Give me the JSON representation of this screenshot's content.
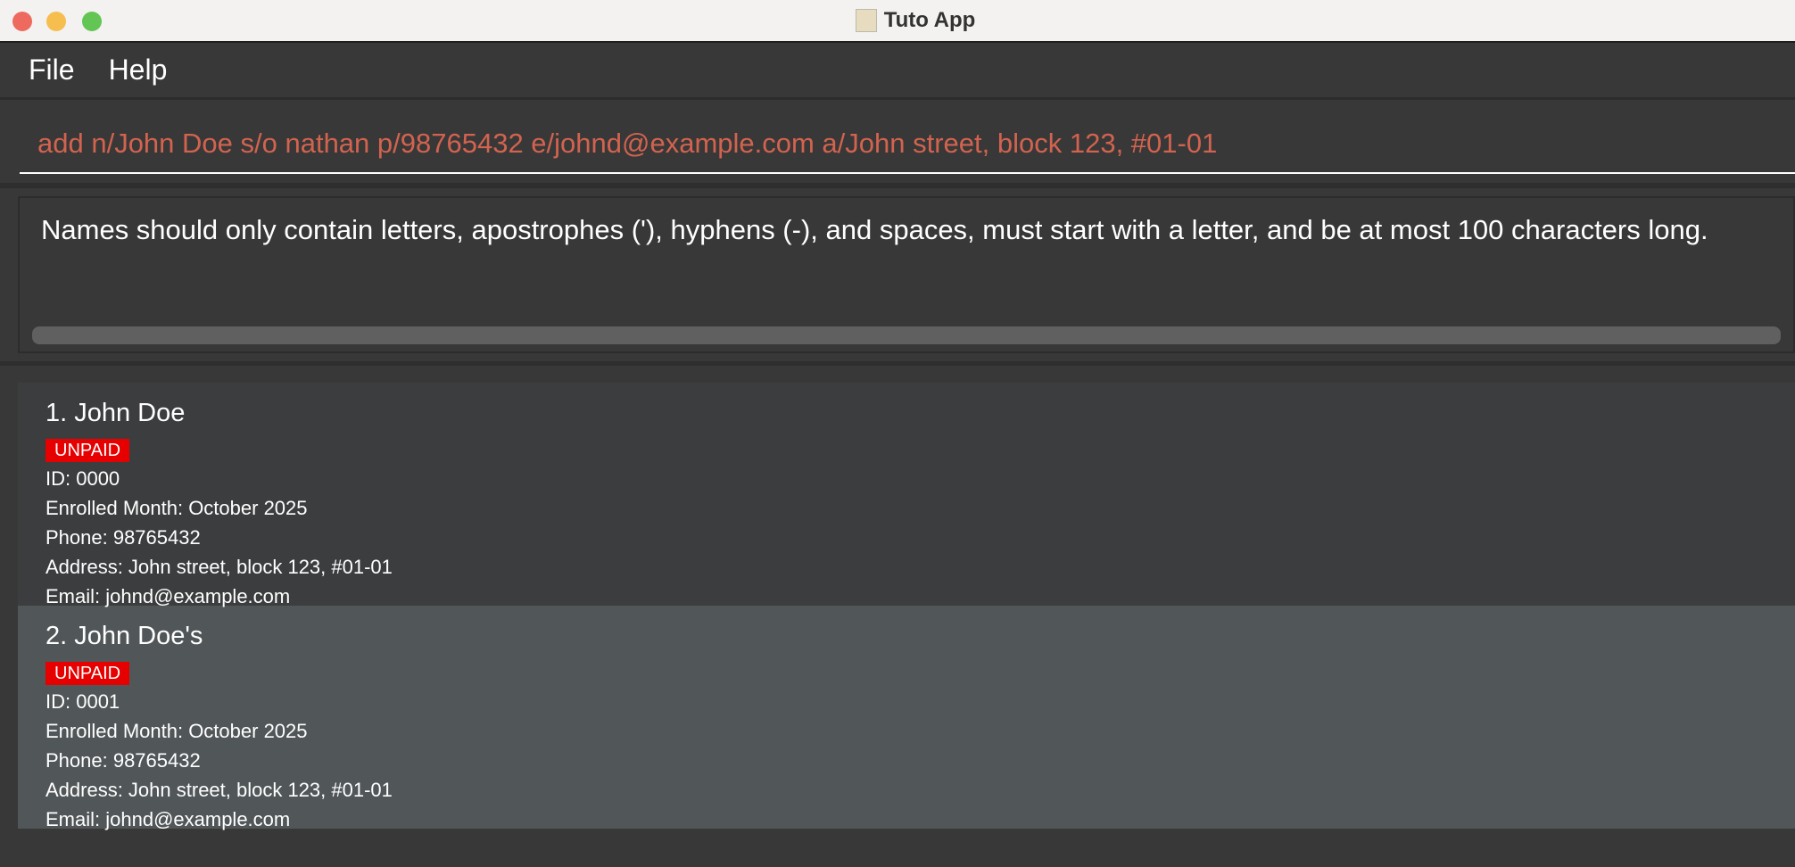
{
  "window": {
    "title": "Tuto App",
    "colors": {
      "close": "#ee6a5f",
      "minimize": "#f5be4f",
      "zoom": "#62c554"
    }
  },
  "menu": {
    "items": [
      "File",
      "Help"
    ]
  },
  "command": {
    "value": "add n/John Doe s/o nathan p/98765432 e/johnd@example.com a/John street, block 123, #01-01",
    "error_color": "#d2634f"
  },
  "result": {
    "text": "Names should only contain letters, apostrophes ('), hyphens (-), and spaces, must start with a letter, and be at most 100 characters long."
  },
  "persons": [
    {
      "name": "1. John Doe",
      "badge": "UNPAID",
      "id": "ID: 0000",
      "enrolled": "Enrolled Month: October 2025",
      "phone": "Phone: 98765432",
      "address": "Address: John street, block 123, #01-01",
      "email": "Email: johnd@example.com"
    },
    {
      "name": "2. John Doe's",
      "badge": "UNPAID",
      "id": "ID: 0001",
      "enrolled": "Enrolled Month: October 2025",
      "phone": "Phone: 98765432",
      "address": "Address: John street, block 123, #01-01",
      "email": "Email: johnd@example.com"
    }
  ]
}
